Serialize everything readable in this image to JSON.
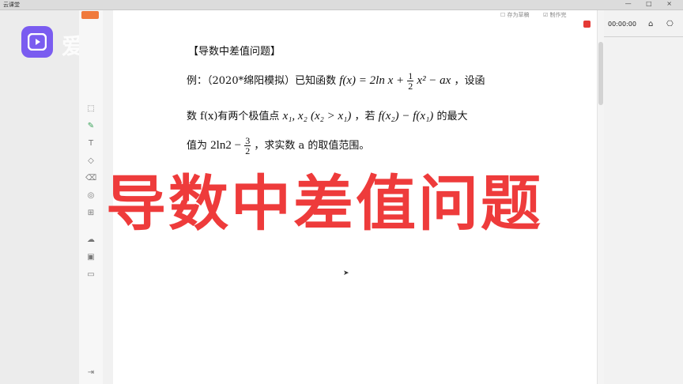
{
  "window": {
    "app_title": "云课堂",
    "controls": "— □ ×"
  },
  "brand": {
    "logo_text": "爱"
  },
  "page_toolbar": {
    "save_label": "存为草稿",
    "share_label": "制作完"
  },
  "recording": {
    "timer": "00:00:00"
  },
  "document": {
    "heading": "【导数中差值问题】",
    "line1": {
      "prefix": "例：（2020*绵阳模拟）已知函数",
      "func": "f(x) = 2ln x +",
      "frac_num": "1",
      "frac_den": "2",
      "func_tail": "x² − ax",
      "suffix": "，设函"
    },
    "line2": {
      "prefix": "数 f(x)有两个极值点",
      "vars": "x₁, x₂",
      "cond": "(x₂ > x₁)",
      "mid": "，若",
      "expr": "f(x₂) − f(x₁)",
      "suffix": "的最大"
    },
    "line3": {
      "prefix": "值为",
      "val": "2ln2 −",
      "frac_num": "3",
      "frac_den": "2",
      "suffix": "，求实数 a 的取值范围。"
    }
  },
  "overlay_title": "导数中差值问题",
  "colors": {
    "accent": "#ee3b3b",
    "logo": "#7a5cf0",
    "record": "#e53935"
  }
}
